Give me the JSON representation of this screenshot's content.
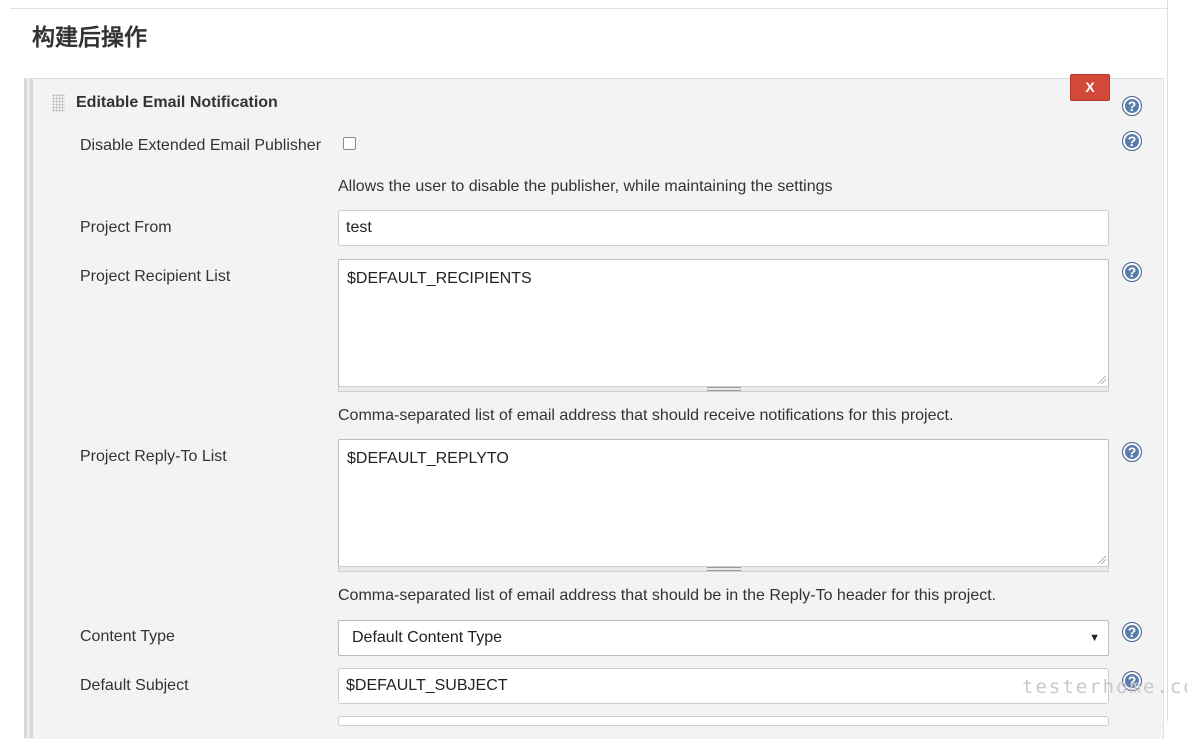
{
  "section": {
    "title": "构建后操作"
  },
  "block": {
    "title": "Editable Email Notification",
    "delete_label": "X",
    "help_glyph": "?"
  },
  "fields": {
    "disable_publisher": {
      "label": "Disable Extended Email Publisher",
      "checked": false,
      "description": "Allows the user to disable the publisher, while maintaining the settings"
    },
    "project_from": {
      "label": "Project From",
      "value": "test"
    },
    "recipient_list": {
      "label": "Project Recipient List",
      "value": "$DEFAULT_RECIPIENTS",
      "description": "Comma-separated list of email address that should receive notifications for this project."
    },
    "reply_to_list": {
      "label": "Project Reply-To List",
      "value": "$DEFAULT_REPLYTO",
      "description": "Comma-separated list of email address that should be in the Reply-To header for this project."
    },
    "content_type": {
      "label": "Content Type",
      "selected": "Default Content Type",
      "arrow": "▼"
    },
    "default_subject": {
      "label": "Default Subject",
      "value": "$DEFAULT_SUBJECT"
    }
  },
  "watermark": {
    "text": "testerhome.com"
  },
  "colors": {
    "delete_button": "#d24939",
    "help_icon": "#5b7dab",
    "panel_background": "#f3f3f3"
  },
  "icons": {
    "help": "help-icon",
    "delete": "close-icon",
    "drag": "drag-handle-icon"
  }
}
